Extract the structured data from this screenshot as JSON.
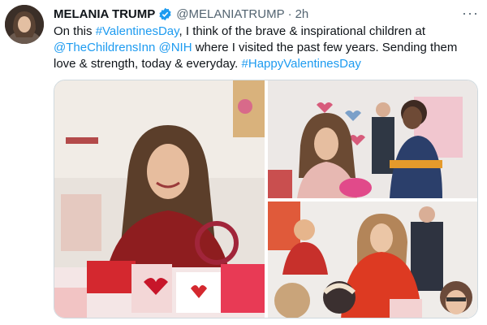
{
  "author": {
    "name": "MELANIA TRUMP",
    "handle": "@MELANIATRUMP",
    "separator": "·",
    "time": "2h",
    "verified_icon": "verified-badge-icon",
    "badge_color": "#1d9bf0"
  },
  "tweet": {
    "line1_a": "On this ",
    "tag_valentines": "#ValentinesDay",
    "line1_b": ", I think of the brave & inspirational children at",
    "mention_inn": "@TheChildrensInn",
    "space": " ",
    "mention_nih": "@NIH",
    "line2_b": " where I visited the past few years. Sending them",
    "line3_a": "love & strength, today & everyday. ",
    "tag_happy": "#HappyValentinesDay"
  },
  "menu": {
    "more_label": "···",
    "more_icon": "more-icon"
  },
  "media": {
    "photos": [
      {
        "icon": "photo-valentine-crafts-table"
      },
      {
        "icon": "photo-valentine-with-child"
      },
      {
        "icon": "photo-valentine-crafts-group"
      }
    ]
  },
  "colors": {
    "link": "#1d9bf0",
    "text": "#0f1419",
    "secondary": "#536471"
  }
}
